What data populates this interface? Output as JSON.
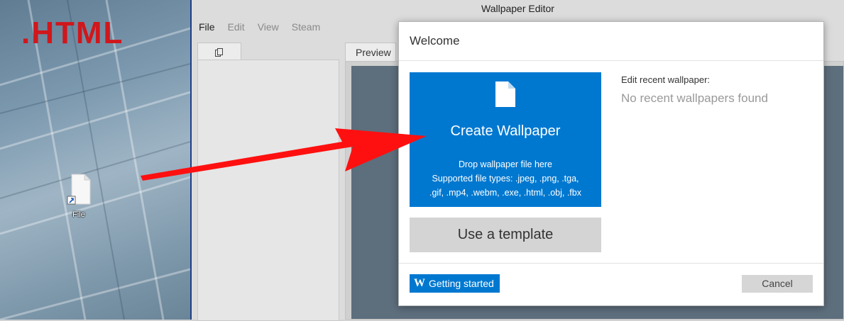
{
  "desktop": {
    "overlay_label": ".HTML",
    "file_icon_label": "File"
  },
  "editor": {
    "window_title": "Wallpaper Editor",
    "menu": [
      "File",
      "Edit",
      "View",
      "Steam"
    ],
    "preview_tab": "Preview"
  },
  "dialog": {
    "title": "Welcome",
    "create": {
      "title": "Create Wallpaper",
      "desc_line1": "Drop wallpaper file here",
      "desc_line2": "Supported file types: .jpeg, .png, .tga,",
      "desc_line3": ".gif, .mp4, .webm, .exe, .html, .obj, .fbx"
    },
    "template_label": "Use a template",
    "recent_label": "Edit recent wallpaper:",
    "recent_empty": "No recent wallpapers found",
    "getting_started_label": "Getting started",
    "getting_started_icon_letter": "W",
    "cancel_label": "Cancel"
  },
  "colors": {
    "accent": "#0078d0",
    "overlay_text": "#d0171c",
    "arrow": "#ff1010"
  }
}
